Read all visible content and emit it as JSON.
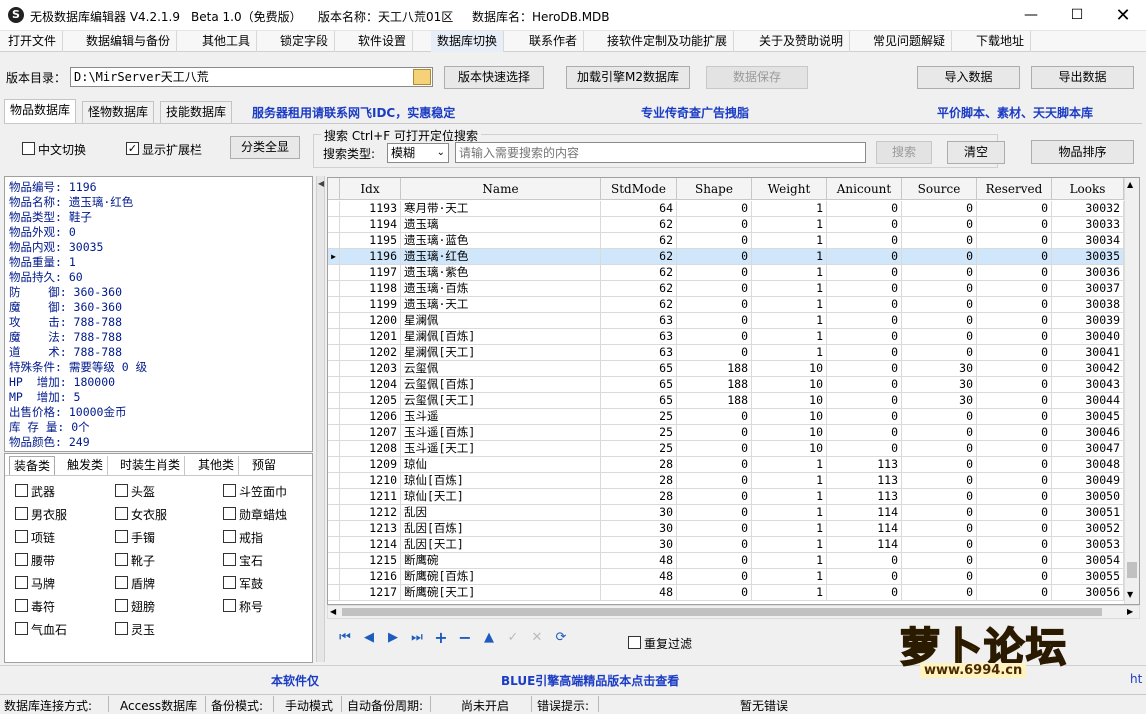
{
  "window": {
    "title_app": "无极数据库编辑器 V4.2.1.9",
    "title_beta": "Beta 1.0（免费版）",
    "title_version_name": "版本名称：天工八荒01区",
    "title_db_name": "数据库名：HeroDB.MDB",
    "app_icon": "S"
  },
  "menu": [
    "打开文件",
    "数据编辑与备份",
    "其他工具",
    "锁定字段",
    "软件设置",
    "数据库切换",
    "联系作者",
    "接软件定制及功能扩展",
    "关于及赞助说明",
    "常见问题解疑",
    "下载地址"
  ],
  "toolbar": {
    "version_dir_label": "版本目录：",
    "version_dir_value": "D:\\MirServer天工八荒",
    "quick_select": "版本快速选择",
    "load_engine": "加载引擎M2数据库",
    "save_data": "数据保存",
    "import_data": "导入数据",
    "export_data": "导出数据"
  },
  "tabs": [
    "物品数据库",
    "怪物数据库",
    "技能数据库"
  ],
  "ads": {
    "ad1": "服务器租用请联系网飞IDC，实惠稳定",
    "ad2": "专业传奇查广告拽脂",
    "ad3": "平价脚本、素材、天天脚本库"
  },
  "options": {
    "chinese_switch": "中文切换",
    "show_ext": "显示扩展栏",
    "show_all": "分类全显",
    "search_hint": "搜索   Ctrl+F 可打开定位搜索",
    "search_type_label": "搜索类型:",
    "search_type_value": "模糊",
    "search_placeholder": "请输入需要搜索的内容",
    "search_btn": "搜索",
    "clear_btn": "清空",
    "sort_btn": "物品排序"
  },
  "item_info": [
    "物品编号: 1196",
    "物品名称: 遗玉璃·红色",
    "物品类型: 鞋子",
    "物品外观: 0",
    "物品内观: 30035",
    "物品重量: 1",
    "物品持久: 60",
    "防    御: 360-360",
    "魔    御: 360-360",
    "攻    击: 788-788",
    "魔    法: 788-788",
    "道    术: 788-788",
    "特殊条件: 需要等级 0 级",
    "HP  增加: 180000",
    "MP  增加: 5",
    "出售价格: 10000金币",
    "库 存 量: 0个",
    "物品颜色: 249"
  ],
  "category_tabs": [
    "装备类",
    "触发类",
    "时装生肖类",
    "其他类",
    "预留"
  ],
  "categories": [
    [
      "武器",
      "头盔",
      "斗笠面巾"
    ],
    [
      "男衣服",
      "女衣服",
      "勋章蜡烛"
    ],
    [
      "项链",
      "手镯",
      "戒指"
    ],
    [
      "腰带",
      "靴子",
      "宝石"
    ],
    [
      "马牌",
      "盾牌",
      "军鼓"
    ],
    [
      "毒符",
      "翅膀",
      "称号"
    ],
    [
      "气血石",
      "灵玉",
      ""
    ]
  ],
  "grid": {
    "columns": [
      "Idx",
      "Name",
      "StdMode",
      "Shape",
      "Weight",
      "Anicount",
      "Source",
      "Reserved",
      "Looks"
    ],
    "selected_index": 3,
    "rows": [
      [
        "1193",
        "寒月带·天工",
        "64",
        "0",
        "1",
        "0",
        "0",
        "0",
        "30032"
      ],
      [
        "1194",
        "遗玉璃",
        "62",
        "0",
        "1",
        "0",
        "0",
        "0",
        "30033"
      ],
      [
        "1195",
        "遗玉璃·蓝色",
        "62",
        "0",
        "1",
        "0",
        "0",
        "0",
        "30034"
      ],
      [
        "1196",
        "遗玉璃·红色",
        "62",
        "0",
        "1",
        "0",
        "0",
        "0",
        "30035"
      ],
      [
        "1197",
        "遗玉璃·紫色",
        "62",
        "0",
        "1",
        "0",
        "0",
        "0",
        "30036"
      ],
      [
        "1198",
        "遗玉璃·百炼",
        "62",
        "0",
        "1",
        "0",
        "0",
        "0",
        "30037"
      ],
      [
        "1199",
        "遗玉璃·天工",
        "62",
        "0",
        "1",
        "0",
        "0",
        "0",
        "30038"
      ],
      [
        "1200",
        "星澜佩",
        "63",
        "0",
        "1",
        "0",
        "0",
        "0",
        "30039"
      ],
      [
        "1201",
        "星澜佩[百炼]",
        "63",
        "0",
        "1",
        "0",
        "0",
        "0",
        "30040"
      ],
      [
        "1202",
        "星澜佩[天工]",
        "63",
        "0",
        "1",
        "0",
        "0",
        "0",
        "30041"
      ],
      [
        "1203",
        "云玺佩",
        "65",
        "188",
        "10",
        "0",
        "30",
        "0",
        "30042"
      ],
      [
        "1204",
        "云玺佩[百炼]",
        "65",
        "188",
        "10",
        "0",
        "30",
        "0",
        "30043"
      ],
      [
        "1205",
        "云玺佩[天工]",
        "65",
        "188",
        "10",
        "0",
        "30",
        "0",
        "30044"
      ],
      [
        "1206",
        "玉斗遥",
        "25",
        "0",
        "10",
        "0",
        "0",
        "0",
        "30045"
      ],
      [
        "1207",
        "玉斗遥[百炼]",
        "25",
        "0",
        "10",
        "0",
        "0",
        "0",
        "30046"
      ],
      [
        "1208",
        "玉斗遥[天工]",
        "25",
        "0",
        "10",
        "0",
        "0",
        "0",
        "30047"
      ],
      [
        "1209",
        "琼仙",
        "28",
        "0",
        "1",
        "113",
        "0",
        "0",
        "30048"
      ],
      [
        "1210",
        "琼仙[百炼]",
        "28",
        "0",
        "1",
        "113",
        "0",
        "0",
        "30049"
      ],
      [
        "1211",
        "琼仙[天工]",
        "28",
        "0",
        "1",
        "113",
        "0",
        "0",
        "30050"
      ],
      [
        "1212",
        "乱因",
        "30",
        "0",
        "1",
        "114",
        "0",
        "0",
        "30051"
      ],
      [
        "1213",
        "乱因[百炼]",
        "30",
        "0",
        "1",
        "114",
        "0",
        "0",
        "30052"
      ],
      [
        "1214",
        "乱因[天工]",
        "30",
        "0",
        "1",
        "114",
        "0",
        "0",
        "30053"
      ],
      [
        "1215",
        "断鹰碗",
        "48",
        "0",
        "1",
        "0",
        "0",
        "0",
        "30054"
      ],
      [
        "1216",
        "断鹰碗[百炼]",
        "48",
        "0",
        "1",
        "0",
        "0",
        "0",
        "30055"
      ],
      [
        "1217",
        "断鹰碗[天工]",
        "48",
        "0",
        "1",
        "0",
        "0",
        "0",
        "30056"
      ]
    ]
  },
  "nav": {
    "icons": [
      "first-icon",
      "prev-icon",
      "next-icon",
      "last-icon",
      "add-icon",
      "delete-icon",
      "up-icon",
      "confirm-icon",
      "cancel-icon",
      "refresh-icon"
    ],
    "dup_filter": "重复过滤"
  },
  "footer": {
    "left_ad": "本软件仅",
    "blue_ad": "BLUE引擎高端精品版本点击查看",
    "watermark": "萝卜论坛",
    "watermark_url": "www.6994.cn",
    "trailing": "ht"
  },
  "status": {
    "conn_label": "数据库连接方式:",
    "conn_value": "Access数据库",
    "backup_label": "备份模式:",
    "backup_value": "手动模式",
    "auto_label": "自动备份周期:",
    "auto_value": "尚未开启",
    "err_label": "错误提示:",
    "err_value": "暂无错误"
  }
}
